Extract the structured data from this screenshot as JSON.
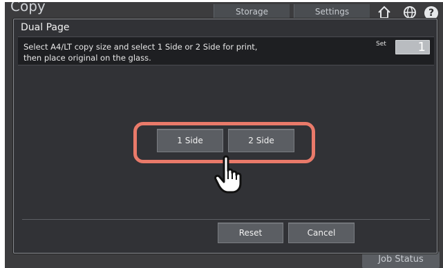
{
  "background": {
    "app_title": "Copy",
    "tabs": [
      "Storage",
      "Settings"
    ],
    "icons": [
      "home-icon",
      "globe-icon",
      "help-icon"
    ],
    "help_label": "?",
    "job_status_label": "Job Status"
  },
  "dialog": {
    "title": "Dual Page",
    "instruction": "Select A4/LT copy size and select 1 Side or 2 Side for print,\nthen place original on the glass.",
    "set_label": "Set",
    "set_value": "1",
    "options": [
      "1 Side",
      "2 Side"
    ],
    "reset_label": "Reset",
    "cancel_label": "Cancel",
    "highlight_color": "#e97a6a"
  }
}
